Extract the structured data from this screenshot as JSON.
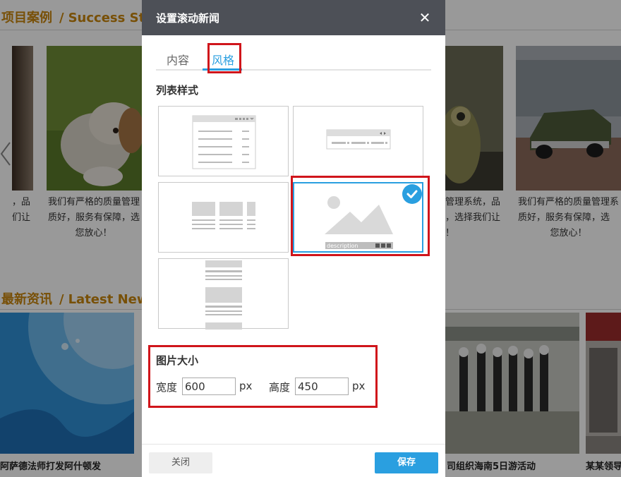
{
  "background": {
    "cases_title_cn": "项目案例",
    "cases_title_en": "Success Stories",
    "news_title_cn": "最新资讯",
    "news_title_en": "Latest News",
    "title_sep": "/",
    "captions": [
      {
        "lines": [
          "，品",
          "们让"
        ]
      },
      {
        "lines": [
          "我们有严格的质量管理",
          "质好，服务有保障，选",
          "您放心！"
        ]
      },
      {
        "lines": [
          "管理系统，品",
          "，选择我们让",
          "！"
        ]
      },
      {
        "lines": [
          "我们有严格的质量管理系",
          "质好，服务有保障，选",
          "您放心！"
        ]
      }
    ],
    "news_captions": [
      "阿萨德法师打发阿什顿发",
      "司组织海南5日游活动",
      "某某领导"
    ]
  },
  "dialog": {
    "title": "设置滚动新闻",
    "close_glyph": "✕",
    "tabs": [
      {
        "label": "内容",
        "active": false
      },
      {
        "label": "风格",
        "active": true
      }
    ],
    "list_style_title": "列表样式",
    "style_options": [
      {
        "id": "list",
        "selected": false
      },
      {
        "id": "single-line",
        "selected": false
      },
      {
        "id": "columns",
        "selected": false
      },
      {
        "id": "image-slide",
        "selected": true,
        "thumb_label": "description"
      },
      {
        "id": "stacked",
        "selected": false
      }
    ],
    "image_size_title": "图片大小",
    "width_label": "宽度",
    "width_value": "600",
    "height_label": "高度",
    "height_value": "450",
    "unit": "px",
    "close_button": "关闭",
    "save_button": "保存"
  },
  "colors": {
    "accent": "#2a9fe0",
    "highlight_red": "#d0151b",
    "section_title": "#c9850d",
    "header_bg": "#4d5057"
  }
}
